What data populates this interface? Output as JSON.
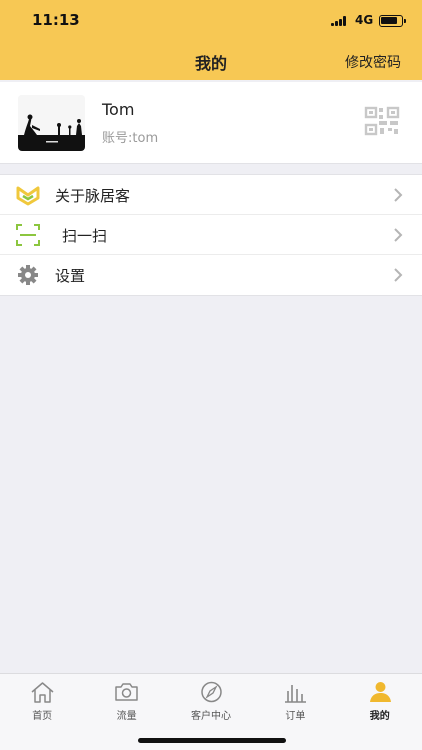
{
  "status_bar": {
    "time": "11:13",
    "network": "4G"
  },
  "nav": {
    "title": "我的",
    "action_label": "修改密码"
  },
  "profile": {
    "name": "Tom",
    "account_label": "账号",
    "account_value": "tom"
  },
  "menu": {
    "items": [
      {
        "label": "关于脉居客",
        "icon": "brand-m-icon"
      },
      {
        "label": "扫一扫",
        "icon": "scan-icon"
      },
      {
        "label": "设置",
        "icon": "gear-icon"
      }
    ]
  },
  "tabbar": {
    "items": [
      {
        "label": "首页",
        "icon": "home-icon"
      },
      {
        "label": "流量",
        "icon": "camera-icon"
      },
      {
        "label": "客户中心",
        "icon": "compass-icon"
      },
      {
        "label": "订单",
        "icon": "bar-chart-icon"
      },
      {
        "label": "我的",
        "icon": "person-icon",
        "active": true
      }
    ]
  },
  "colors": {
    "accent": "#f7c854",
    "icon_green": "#8cc63f",
    "icon_yellow": "#f0c83c",
    "background": "#efeff4"
  }
}
